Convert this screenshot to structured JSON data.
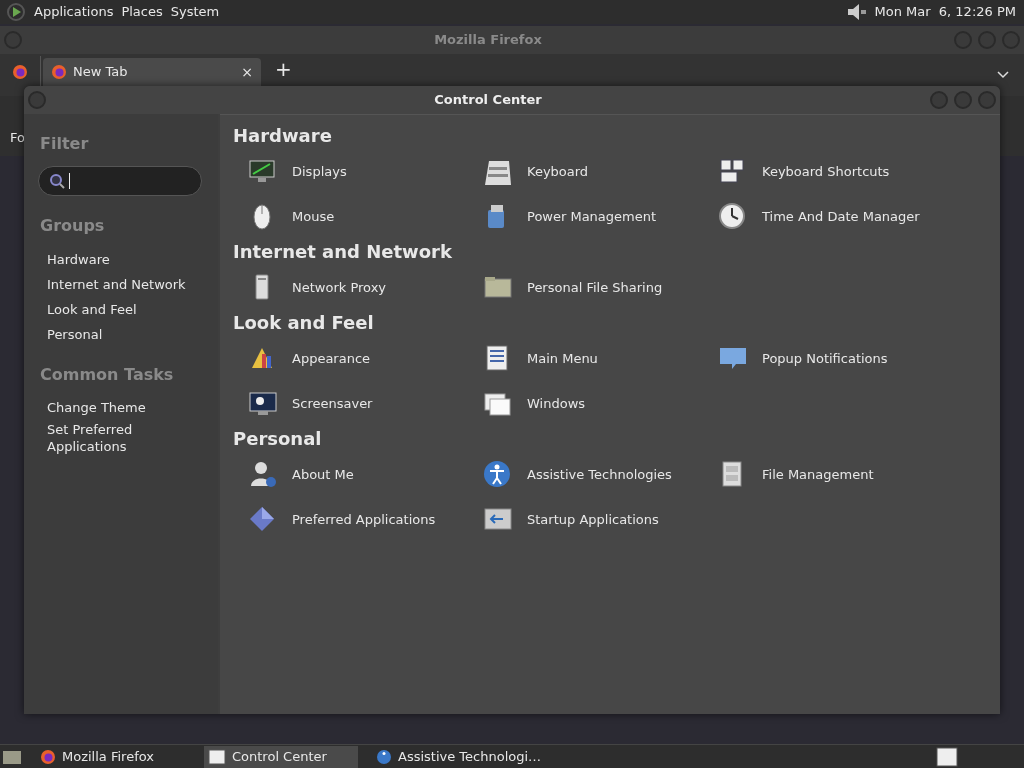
{
  "top_panel": {
    "menus": [
      "Applications",
      "Places",
      "System"
    ],
    "clock": "Mon Mar  6, 12:26 PM"
  },
  "browser": {
    "title": "Mozilla Firefox",
    "tabs": [
      {
        "label": "New Tab",
        "close": "×",
        "selected": true
      }
    ],
    "new_tab": "+",
    "page_text": "Fo"
  },
  "control_center": {
    "title": "Control Center",
    "sidebar": {
      "filter_label": "Filter",
      "groups_label": "Groups",
      "groups": [
        "Hardware",
        "Internet and Network",
        "Look and Feel",
        "Personal"
      ],
      "tasks_label": "Common Tasks",
      "tasks": [
        "Change Theme",
        "Set Preferred Applications"
      ]
    },
    "sections": [
      {
        "title": "Hardware",
        "items": [
          "Displays",
          "Keyboard",
          "Keyboard Shortcuts",
          "Mouse",
          "Power Management",
          "Time And Date Manager"
        ]
      },
      {
        "title": "Internet and Network",
        "items": [
          "Network Proxy",
          "Personal File Sharing"
        ]
      },
      {
        "title": "Look and Feel",
        "items": [
          "Appearance",
          "Main Menu",
          "Popup Notifications",
          "Screensaver",
          "Windows"
        ]
      },
      {
        "title": "Personal",
        "items": [
          "About Me",
          "Assistive Technologies",
          "File Management",
          "Preferred Applications",
          "Startup Applications"
        ]
      }
    ]
  },
  "taskbar": {
    "items": [
      {
        "label": "Mozilla Firefox",
        "selected": false
      },
      {
        "label": "Control Center",
        "selected": true
      },
      {
        "label": "Assistive Technologi…",
        "selected": false
      }
    ]
  }
}
